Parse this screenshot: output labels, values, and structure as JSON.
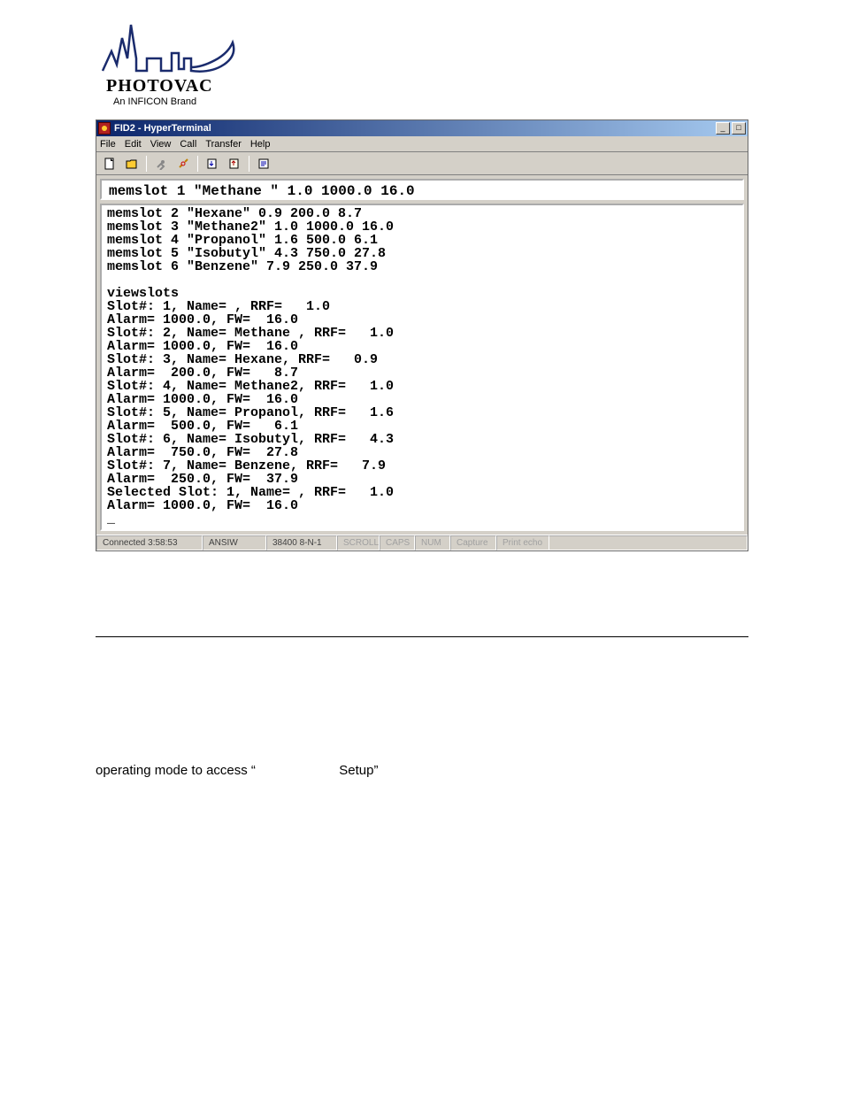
{
  "logo": {
    "name": "PHOTOVAC",
    "tag": "An INFICON Brand"
  },
  "window": {
    "title": "FID2 - HyperTerminal",
    "menu": [
      "File",
      "Edit",
      "View",
      "Call",
      "Transfer",
      "Help"
    ],
    "toolbar": [
      "new-file-icon",
      "open-icon",
      "sep",
      "connect-icon",
      "disconnect-icon",
      "sep",
      "send-icon",
      "receive-icon",
      "sep",
      "properties-icon"
    ],
    "top_line": "memslot 1 \"Methane \" 1.0 1000.0 16.0",
    "terminal_lines": [
      "memslot 2 \"Hexane\" 0.9 200.0 8.7",
      "memslot 3 \"Methane2\" 1.0 1000.0 16.0",
      "memslot 4 \"Propanol\" 1.6 500.0 6.1",
      "memslot 5 \"Isobutyl\" 4.3 750.0 27.8",
      "memslot 6 \"Benzene\" 7.9 250.0 37.9",
      "",
      "viewslots",
      "Slot#: 1, Name= , RRF=   1.0",
      "Alarm= 1000.0, FW=  16.0",
      "Slot#: 2, Name= Methane , RRF=   1.0",
      "Alarm= 1000.0, FW=  16.0",
      "Slot#: 3, Name= Hexane, RRF=   0.9",
      "Alarm=  200.0, FW=   8.7",
      "Slot#: 4, Name= Methane2, RRF=   1.0",
      "Alarm= 1000.0, FW=  16.0",
      "Slot#: 5, Name= Propanol, RRF=   1.6",
      "Alarm=  500.0, FW=   6.1",
      "Slot#: 6, Name= Isobutyl, RRF=   4.3",
      "Alarm=  750.0, FW=  27.8",
      "Slot#: 7, Name= Benzene, RRF=   7.9",
      "Alarm=  250.0, FW=  37.9",
      "Selected Slot: 1, Name= , RRF=   1.0",
      "Alarm= 1000.0, FW=  16.0",
      "_"
    ],
    "status": {
      "connected": "Connected 3:58:53",
      "emu": "ANSIW",
      "conn": "38400 8-N-1",
      "fields": [
        "SCROLL",
        "CAPS",
        "NUM",
        "Capture",
        "Print echo"
      ]
    }
  },
  "doc": {
    "left": "operating mode to access “",
    "right": "Setup”"
  }
}
